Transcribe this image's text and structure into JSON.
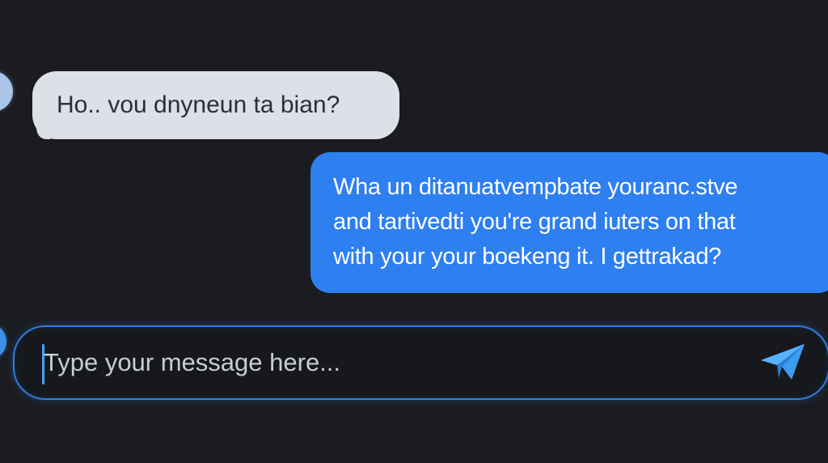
{
  "conversation": {
    "messages": [
      {
        "direction": "incoming",
        "text": "Ho.. vou dnyneun ta bian?"
      },
      {
        "direction": "outgoing",
        "lines": [
          "Wha un ditanuatvempbate youranc.stve",
          "and tartivedti you're grand iuters on that",
          "with your your boekeng it. I gettrakad?"
        ]
      }
    ]
  },
  "composer": {
    "placeholder": "Type your message here...",
    "value": "",
    "send_icon": "paper-plane-icon"
  },
  "colors": {
    "background": "#1b1c1f",
    "incoming_bubble": "#dde0e6",
    "outgoing_bubble": "#2e7ff0",
    "accent": "#2f7fe0",
    "send_icon": "#3b9cf0"
  }
}
